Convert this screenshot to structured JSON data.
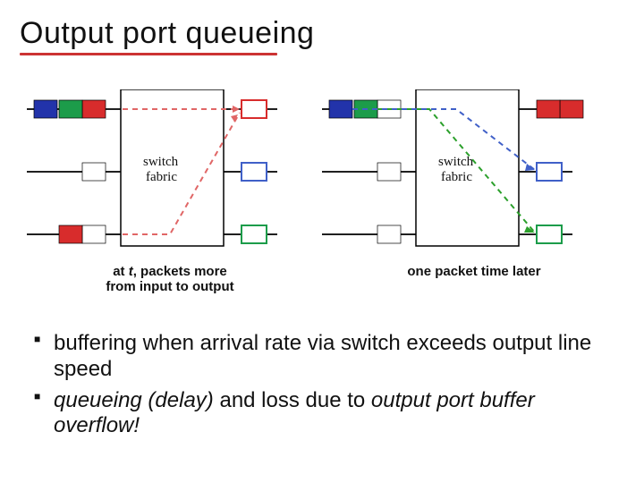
{
  "title": "Output port queueing",
  "diagram": {
    "left": {
      "switch_label_line1": "switch",
      "switch_label_line2": "fabric",
      "caption_prefix": "at ",
      "caption_t": "t",
      "caption_suffix": ", packets more",
      "caption_line2": "from input to output"
    },
    "right": {
      "switch_label_line1": "switch",
      "switch_label_line2": "fabric",
      "caption": "one packet time later"
    }
  },
  "bullets": {
    "b1": "buffering when arrival rate via switch exceeds output line speed",
    "b2_prefix": "queueing (delay)",
    "b2_mid": " and loss due to ",
    "b2_suffix": "output port buffer overflow!"
  },
  "colors": {
    "blue": "#2233aa",
    "green": "#1c9c4a",
    "red": "#d82c2c",
    "red_line": "#e06666",
    "green_line": "#2ca02c",
    "blue_line": "#4060c8",
    "purple": "#7a3fc5"
  }
}
